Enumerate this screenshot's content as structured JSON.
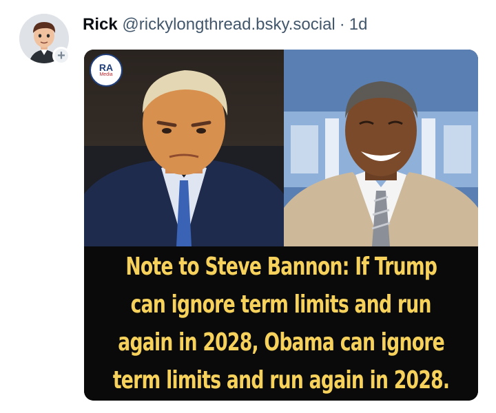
{
  "post": {
    "author_name": "Rick",
    "handle": "@rickylongthread.bsky.social",
    "separator": "·",
    "time": "1d",
    "follow_icon": "plus-icon",
    "follow_glyph": "+"
  },
  "media": {
    "logo": {
      "main": "RA",
      "sub": "Media"
    },
    "caption_lines": [
      "Note to Steve Bannon: If Trump",
      "can ignore term limits and run",
      "again in 2028, Obama can ignore",
      "term limits and run again in 2028."
    ],
    "caption_color": "#f6d25c",
    "background_color": "#0a0a0a"
  }
}
